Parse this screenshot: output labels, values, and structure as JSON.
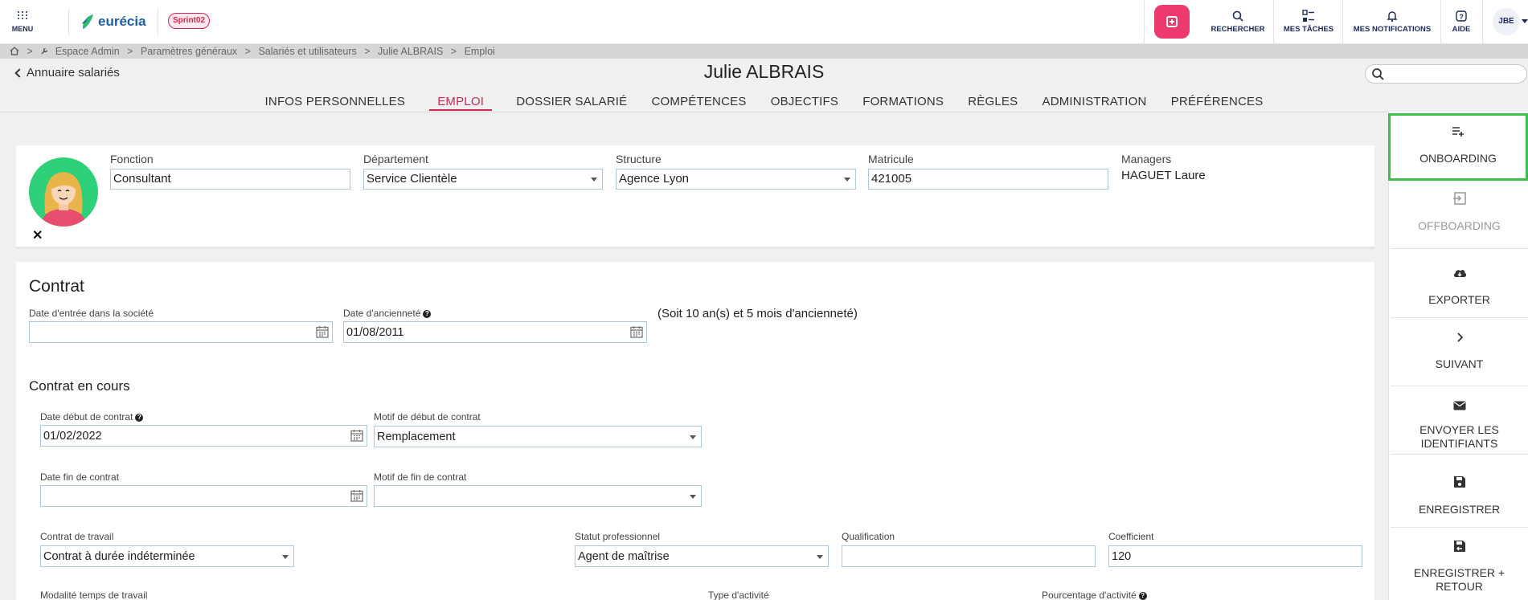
{
  "topbar": {
    "menu_label": "MENU",
    "logo_text": "eurécia",
    "sprint_badge": "Sprint02",
    "actions": [
      {
        "label": "RECHERCHER",
        "icon": "search-icon"
      },
      {
        "label": "MES TÂCHES",
        "icon": "tasks-icon"
      },
      {
        "label": "MES NOTIFICATIONS",
        "icon": "bell-icon"
      },
      {
        "label": "AIDE",
        "icon": "help-icon"
      }
    ],
    "user_initials": "JBE",
    "accent_color": "#ec3a6c"
  },
  "breadcrumb": {
    "items": [
      "Espace Admin",
      "Paramètres généraux",
      "Salariés et utilisateurs",
      "Julie ALBRAIS",
      "Emploi"
    ],
    "separator": ">"
  },
  "header": {
    "back_label": "Annuaire salariés",
    "title": "Julie ALBRAIS",
    "search_placeholder": ""
  },
  "tabs": [
    {
      "label": "INFOS PERSONNELLES",
      "active": false
    },
    {
      "label": "EMPLOI",
      "active": true
    },
    {
      "label": "DOSSIER SALARIÉ",
      "active": false
    },
    {
      "label": "COMPÉTENCES",
      "active": false
    },
    {
      "label": "OBJECTIFS",
      "active": false
    },
    {
      "label": "FORMATIONS",
      "active": false
    },
    {
      "label": "RÈGLES",
      "active": false
    },
    {
      "label": "ADMINISTRATION",
      "active": false
    },
    {
      "label": "PRÉFÉRENCES",
      "active": false
    }
  ],
  "identity": {
    "remove_photo": "✕",
    "fonction": {
      "label": "Fonction",
      "value": "Consultant"
    },
    "departement": {
      "label": "Département",
      "value": "Service Clientèle"
    },
    "structure": {
      "label": "Structure",
      "value": "Agence Lyon"
    },
    "matricule": {
      "label": "Matricule",
      "value": "421005"
    },
    "managers": {
      "label": "Managers",
      "value": "HAGUET Laure"
    }
  },
  "contrat": {
    "title": "Contrat",
    "date_entree": {
      "label": "Date d'entrée dans la société",
      "value": ""
    },
    "date_anciennete": {
      "label": "Date d'ancienneté",
      "value": "01/08/2011"
    },
    "anciennete_text": "(Soit 10 an(s) et 5 mois d'ancienneté)",
    "en_cours": {
      "title": "Contrat en cours",
      "date_debut": {
        "label": "Date début de contrat",
        "value": "01/02/2022"
      },
      "motif_debut": {
        "label": "Motif de début de contrat",
        "value": "Remplacement"
      },
      "date_fin": {
        "label": "Date fin de contrat",
        "value": ""
      },
      "motif_fin": {
        "label": "Motif de fin de contrat",
        "value": ""
      },
      "contrat_travail": {
        "label": "Contrat de travail",
        "value": "Contrat à durée indéterminée"
      },
      "statut": {
        "label": "Statut professionnel",
        "value": "Agent de maîtrise"
      },
      "qualification": {
        "label": "Qualification",
        "value": ""
      },
      "coefficient": {
        "label": "Coefficient",
        "value": "120"
      },
      "modalite": {
        "label": "Modalité temps de travail"
      },
      "type_activite": {
        "label": "Type d'activité"
      },
      "pourcentage": {
        "label": "Pourcentage d'activité"
      }
    }
  },
  "sidebar": {
    "buttons": [
      {
        "label": "ONBOARDING",
        "icon": "playlist-add-icon"
      },
      {
        "label": "OFFBOARDING",
        "icon": "exit-icon"
      },
      {
        "label": "EXPORTER",
        "icon": "cloud-download-icon"
      },
      {
        "label": "SUIVANT",
        "icon": "chevron-right-icon"
      },
      {
        "label": "ENVOYER LES IDENTIFIANTS",
        "icon": "envelope-icon"
      },
      {
        "label": "ENREGISTRER",
        "icon": "save-icon"
      },
      {
        "label": "ENREGISTRER + RETOUR",
        "icon": "save-return-icon"
      }
    ],
    "highlight_color": "#3fbf4a"
  }
}
